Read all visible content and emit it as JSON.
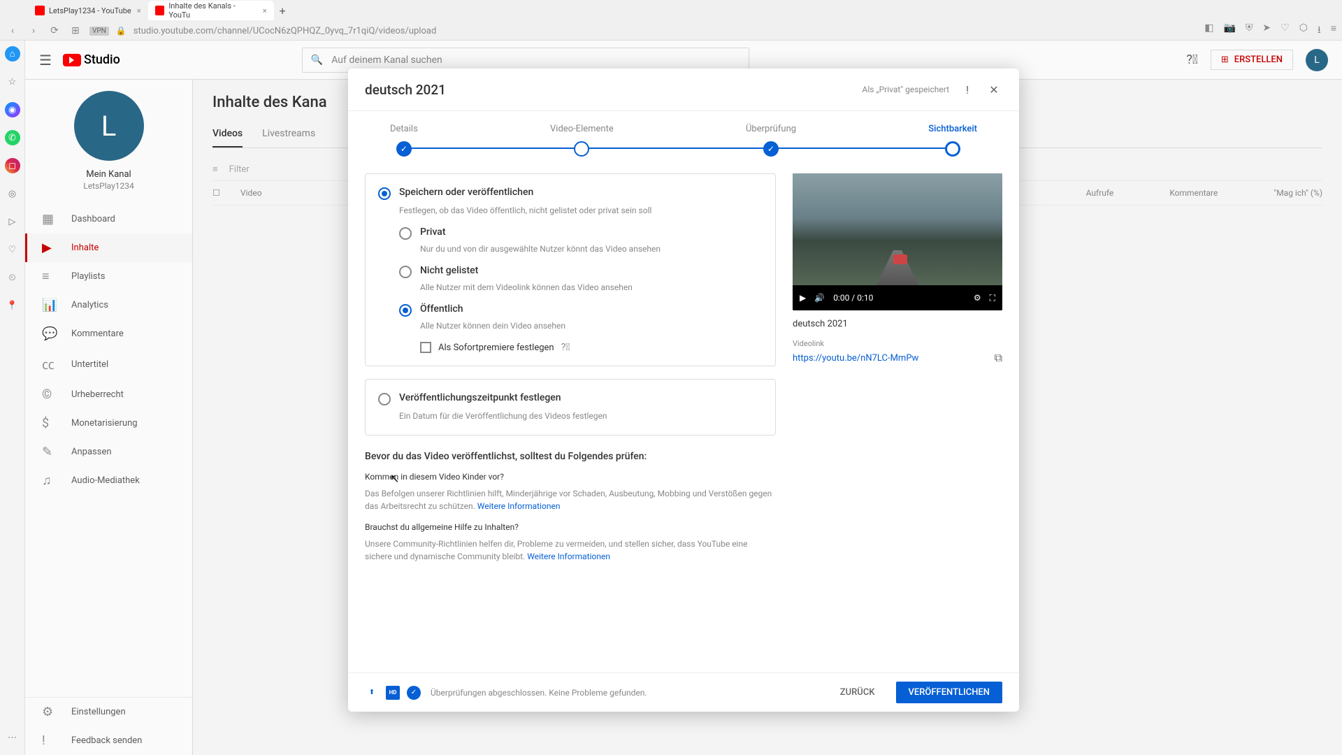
{
  "browser": {
    "tabs": [
      {
        "title": "LetsPlay1234 - YouTube"
      },
      {
        "title": "Inhalte des Kanals - YouTu"
      }
    ],
    "url": "studio.youtube.com/channel/UCocN6zQPHQZ_0yvq_7r1qiQ/videos/upload",
    "vpn": "VPN"
  },
  "topbar": {
    "logo": "Studio",
    "search_placeholder": "Auf deinem Kanal suchen",
    "create": "ERSTELLEN",
    "avatar_letter": "L"
  },
  "channel": {
    "avatar_letter": "L",
    "name_label": "Mein Kanal",
    "handle": "LetsPlay1234"
  },
  "nav": {
    "dashboard": "Dashboard",
    "content": "Inhalte",
    "playlists": "Playlists",
    "analytics": "Analytics",
    "comments": "Kommentare",
    "subtitles": "Untertitel",
    "copyright": "Urheberrecht",
    "monetization": "Monetarisierung",
    "customize": "Anpassen",
    "audio": "Audio-Mediathek",
    "settings": "Einstellungen",
    "feedback": "Feedback senden"
  },
  "main": {
    "title": "Inhalte des Kana",
    "tabs": {
      "videos": "Videos",
      "live": "Livestreams"
    },
    "filter": "Filter",
    "cols": {
      "video": "Video",
      "views": "Aufrufe",
      "comments": "Kommentare",
      "likes": "\"Mag ich\" (%)"
    }
  },
  "modal": {
    "title": "deutsch 2021",
    "saved": "Als „Privat\" gespeichert",
    "steps": {
      "details": "Details",
      "elements": "Video-Elemente",
      "review": "Überprüfung",
      "visibility": "Sichtbarkeit"
    },
    "save_publish": {
      "title": "Speichern oder veröffentlichen",
      "desc": "Festlegen, ob das Video öffentlich, nicht gelistet oder privat sein soll",
      "private": {
        "label": "Privat",
        "desc": "Nur du und von dir ausgewählte Nutzer könnt das Video ansehen"
      },
      "unlisted": {
        "label": "Nicht gelistet",
        "desc": "Alle Nutzer mit dem Videolink können das Video ansehen"
      },
      "public": {
        "label": "Öffentlich",
        "desc": "Alle Nutzer können dein Video ansehen"
      },
      "premiere": "Als Sofortpremiere festlegen"
    },
    "schedule": {
      "title": "Veröffentlichungszeitpunkt festlegen",
      "desc": "Ein Datum für die Veröffentlichung des Videos festlegen"
    },
    "before": {
      "title": "Bevor du das Video veröffentlichst, solltest du Folgendes prüfen:",
      "kids_q": "Kommen in diesem Video Kinder vor?",
      "kids_text": "Das Befolgen unserer Richtlinien hilft, Minderjährige vor Schaden, Ausbeutung, Mobbing und Verstößen gegen das Arbeitsrecht zu schützen. ",
      "help_q": "Brauchst du allgemeine Hilfe zu Inhalten?",
      "help_text": "Unsere Community-Richtlinien helfen dir, Probleme zu vermeiden, und stellen sicher, dass YouTube eine sichere und dynamische Community bleibt. ",
      "link": "Weitere Informationen"
    },
    "video": {
      "time": "0:00 / 0:10",
      "title": "deutsch 2021",
      "link_label": "Videolink",
      "link_url": "https://youtu.be/nN7LC-MmPw"
    },
    "footer": {
      "status": "Überprüfungen abgeschlossen. Keine Probleme gefunden.",
      "back": "ZURÜCK",
      "publish": "VERÖFFENTLICHEN",
      "hd": "HD"
    }
  }
}
